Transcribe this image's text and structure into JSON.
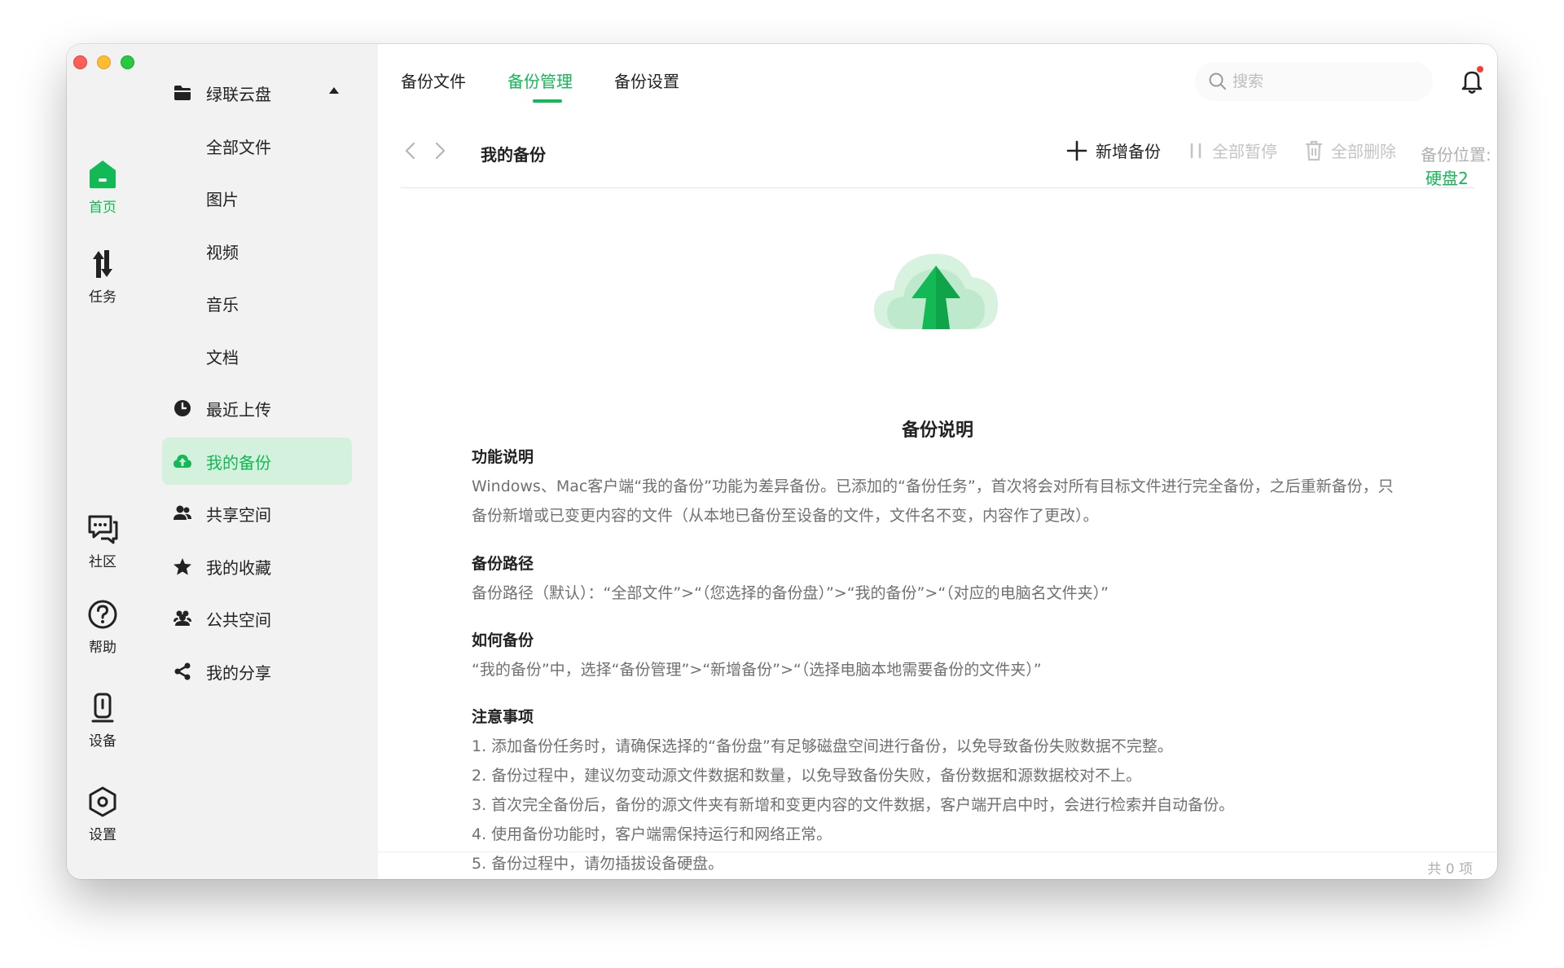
{
  "rail": {
    "items": [
      {
        "label": "首页"
      },
      {
        "label": "任务"
      },
      {
        "label": "社区"
      },
      {
        "label": "帮助"
      },
      {
        "label": "设备"
      },
      {
        "label": "设置"
      }
    ]
  },
  "nav": {
    "drive": "绿联云盘",
    "items": [
      {
        "label": "全部文件"
      },
      {
        "label": "图片"
      },
      {
        "label": "视频"
      },
      {
        "label": "音乐"
      },
      {
        "label": "文档"
      },
      {
        "label": "最近上传"
      },
      {
        "label": "我的备份"
      },
      {
        "label": "共享空间"
      },
      {
        "label": "我的收藏"
      },
      {
        "label": "公共空间"
      },
      {
        "label": "我的分享"
      }
    ]
  },
  "tabs": [
    {
      "label": "备份文件"
    },
    {
      "label": "备份管理"
    },
    {
      "label": "备份设置"
    }
  ],
  "search": {
    "placeholder": "搜索"
  },
  "toolbar": {
    "title": "我的备份",
    "add_label": "新增备份",
    "pause_all_label": "全部暂停",
    "delete_all_label": "全部删除",
    "location_label": "备份位置:",
    "location_value": "硬盘2"
  },
  "content": {
    "title": "备份说明",
    "sections": [
      {
        "heading": "功能说明",
        "lines": [
          "Windows、Mac客户端“我的备份”功能为差异备份。已添加的“备份任务”，首次将会对所有目标文件进行完全备份，之后重新备份，只备份新增或已变更内容的文件（从本地已备份至设备的文件，文件名不变，内容作了更改）。"
        ]
      },
      {
        "heading": "备份路径",
        "lines": [
          "备份路径（默认）：“全部文件”>“（您选择的备份盘）”>“我的备份”>“（对应的电脑名文件夹）”"
        ]
      },
      {
        "heading": "如何备份",
        "lines": [
          "“我的备份”中，选择“备份管理”>“新增备份”>“（选择电脑本地需要备份的文件夹）”"
        ]
      },
      {
        "heading": "注意事项",
        "lines": [
          "1. 添加备份任务时，请确保选择的“备份盘”有足够磁盘空间进行备份，以免导致备份失败数据不完整。",
          "2. 备份过程中，建议勿变动源文件数据和数量，以免导致备份失败，备份数据和源数据校对不上。",
          "3. 首次完全备份后，备份的源文件夹有新增和变更内容的文件数据，客户端开启中时，会进行检索并自动备份。",
          "4. 使用备份功能时，客户端需保持运行和网络正常。",
          "5. 备份过程中，请勿插拔设备硬盘。"
        ]
      }
    ]
  },
  "footer": {
    "count": "共 0 项"
  },
  "colors": {
    "accent": "#13b955",
    "active_bg": "#d3f1dc",
    "rail_bg": "#f2f2f2",
    "notification_dot": "#ff3b30"
  }
}
